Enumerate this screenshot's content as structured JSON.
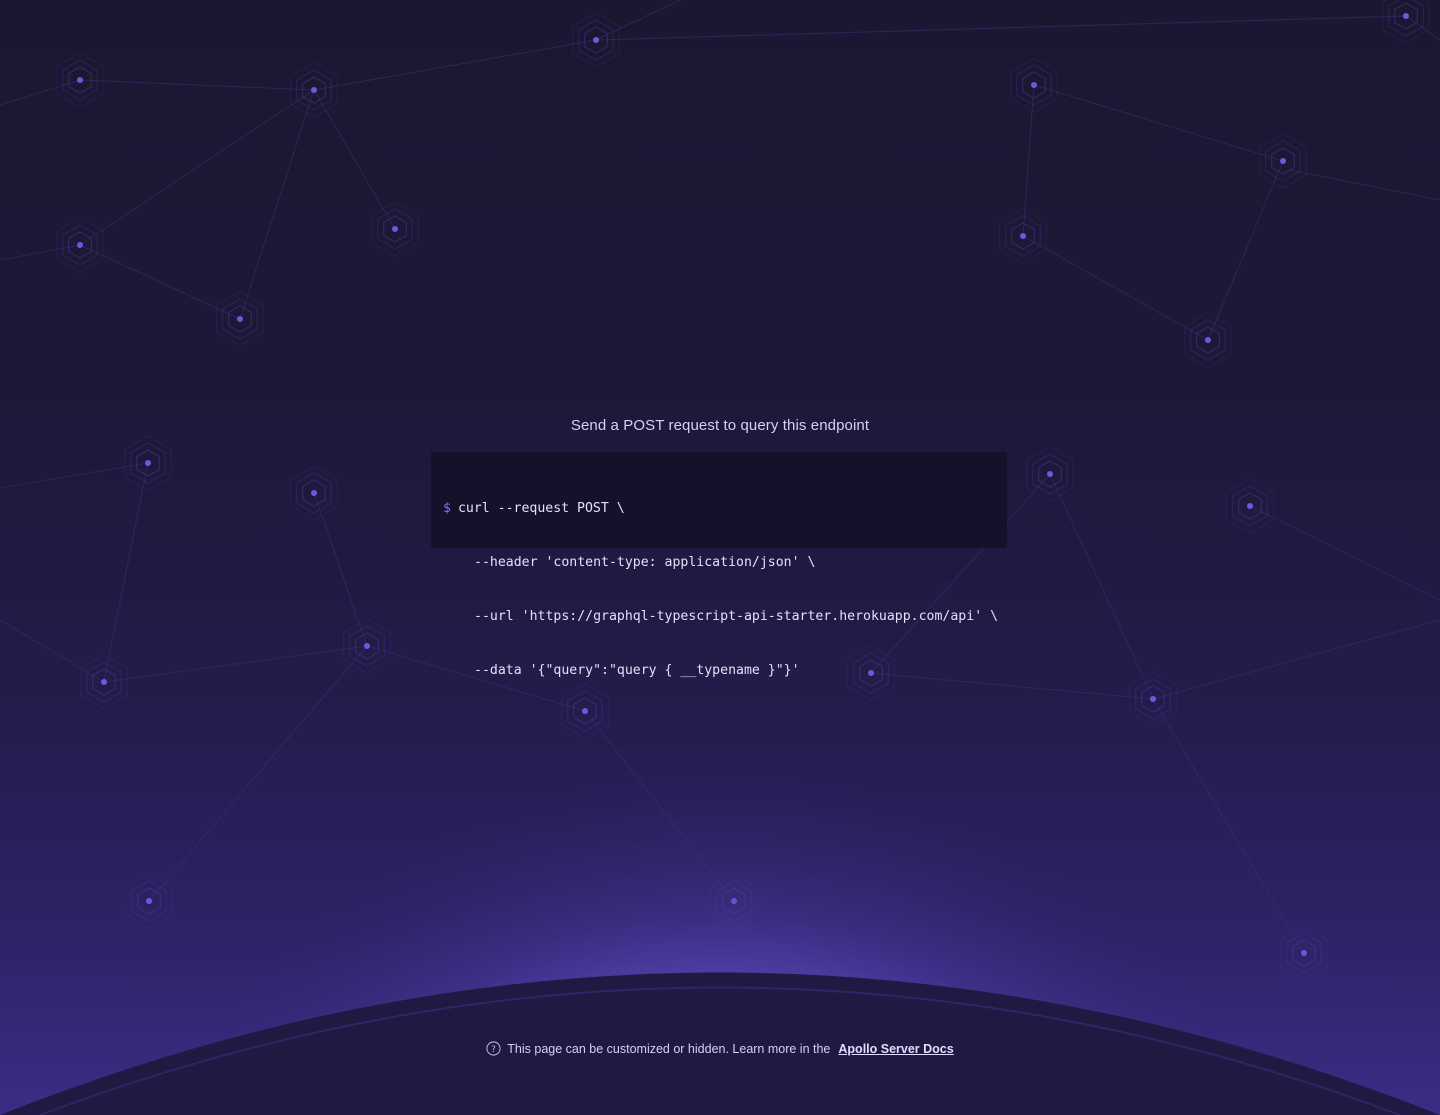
{
  "page": {
    "headline": "Send a POST request to query this endpoint"
  },
  "code": {
    "prompt": "$",
    "lines": [
      "curl --request POST \\",
      "--header 'content-type: application/json' \\",
      "--url 'https://graphql-typescript-api-starter.herokuapp.com/api' \\",
      "--data '{\"query\":\"query { __typename }\"}'"
    ]
  },
  "footer": {
    "icon": "help-circle-icon",
    "text": "This page can be customized or hidden. Learn more in the",
    "link_label": "Apollo Server Docs"
  },
  "colors": {
    "background_top": "#1b1731",
    "background_bottom": "#3a2d86",
    "accent": "#8a6bff",
    "code_background": "#14122b"
  }
}
